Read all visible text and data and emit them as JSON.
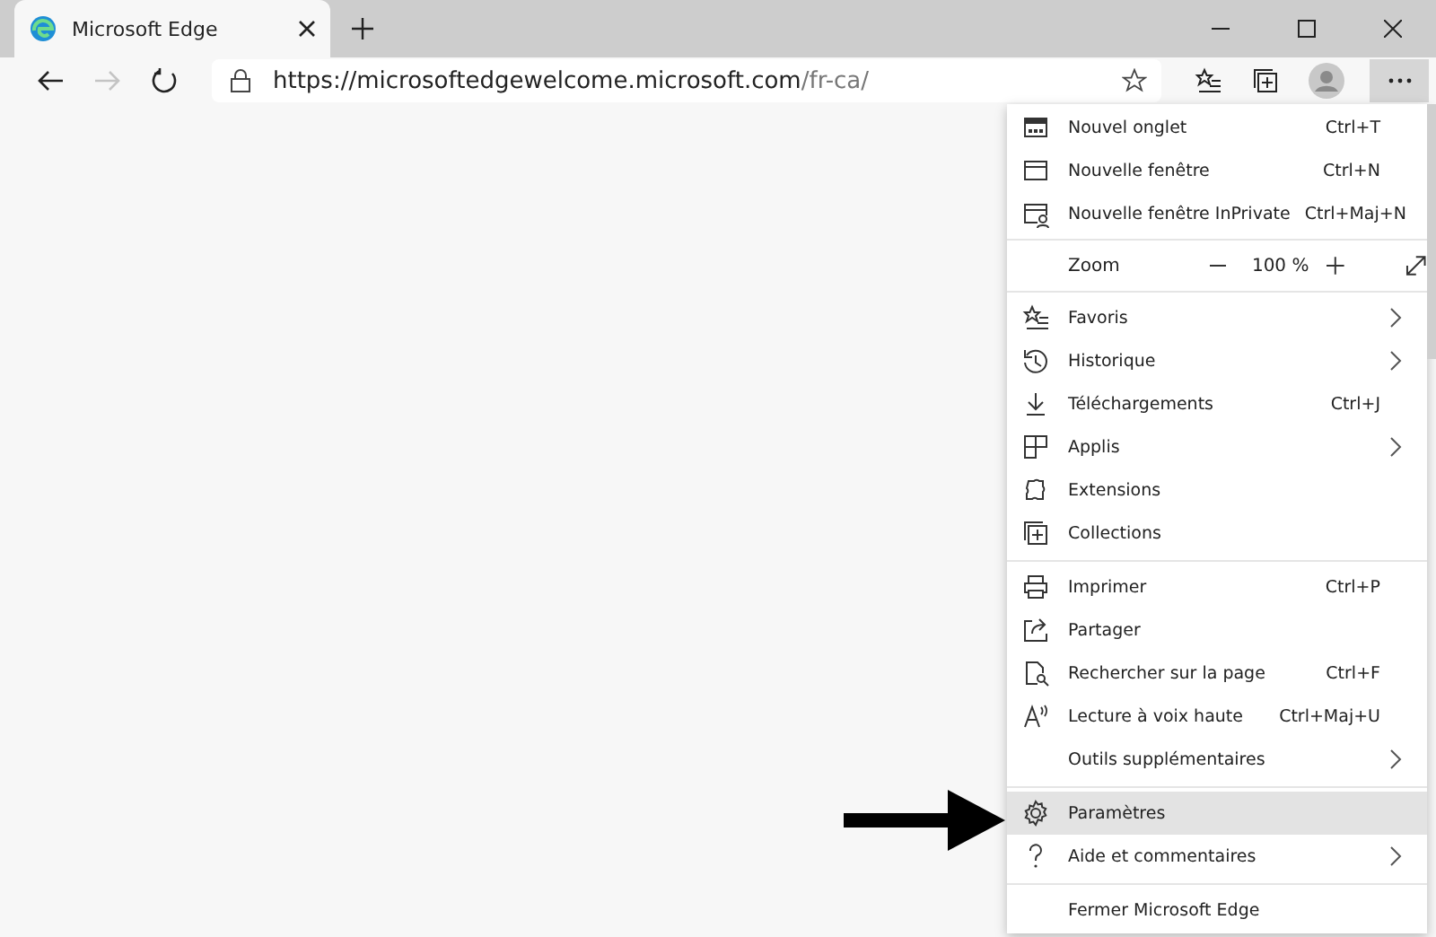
{
  "tab": {
    "title": "Microsoft Edge",
    "selected": true
  },
  "address": {
    "host": "https://microsoftedgewelcome.microsoft.com",
    "path": "/fr-ca/"
  },
  "toolbar": {
    "forward_disabled": true,
    "menu_open": true
  },
  "menu": {
    "items": [
      {
        "kind": "item",
        "label": "Nouvel onglet",
        "shortcut": "Ctrl+T",
        "selected": false
      },
      {
        "kind": "item",
        "label": "Nouvelle fenêtre",
        "shortcut": "Ctrl+N",
        "selected": false
      },
      {
        "kind": "item",
        "label": "Nouvelle fenêtre InPrivate",
        "shortcut": "Ctrl+Maj+N",
        "selected": false
      },
      {
        "kind": "zoom",
        "label": "Zoom",
        "value": "100 %"
      },
      {
        "kind": "item",
        "label": "Favoris",
        "submenu": true,
        "selected": false
      },
      {
        "kind": "item",
        "label": "Historique",
        "submenu": true,
        "selected": false
      },
      {
        "kind": "item",
        "label": "Téléchargements",
        "shortcut": "Ctrl+J",
        "selected": false
      },
      {
        "kind": "item",
        "label": "Applis",
        "submenu": true,
        "selected": false
      },
      {
        "kind": "item",
        "label": "Extensions",
        "selected": false
      },
      {
        "kind": "item",
        "label": "Collections",
        "selected": false
      },
      {
        "kind": "separator"
      },
      {
        "kind": "item",
        "label": "Imprimer",
        "shortcut": "Ctrl+P",
        "selected": false
      },
      {
        "kind": "item",
        "label": "Partager",
        "selected": false
      },
      {
        "kind": "item",
        "label": "Rechercher sur la page",
        "shortcut": "Ctrl+F",
        "selected": false
      },
      {
        "kind": "item",
        "label": "Lecture à voix haute",
        "shortcut": "Ctrl+Maj+U",
        "selected": false
      },
      {
        "kind": "item",
        "label": "Outils supplémentaires",
        "submenu": true,
        "selected": false
      },
      {
        "kind": "separator"
      },
      {
        "kind": "item",
        "label": "Paramètres",
        "selected": true
      },
      {
        "kind": "item",
        "label": "Aide et commentaires",
        "submenu": true,
        "selected": false
      },
      {
        "kind": "separator"
      },
      {
        "kind": "item",
        "label": "Fermer Microsoft Edge",
        "selected": false
      }
    ]
  }
}
